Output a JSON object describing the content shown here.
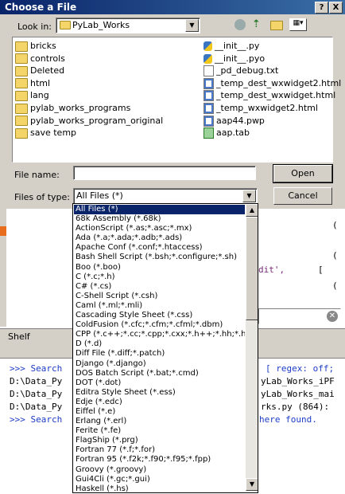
{
  "window": {
    "title": "Choose a File",
    "help_label": "?",
    "close_label": "X"
  },
  "look_in": {
    "label": "Look in:",
    "value": "PyLab_Works"
  },
  "files_left": [
    "bricks",
    "controls",
    "Deleted",
    "html",
    "lang",
    "pylab_works_programs",
    "pylab_works_program_original",
    "save temp"
  ],
  "files_right": [
    {
      "name": "__init__.py",
      "icon": "python-file-icon"
    },
    {
      "name": "__init__.pyo",
      "icon": "python-file-icon"
    },
    {
      "name": "_pd_debug.txt",
      "icon": "text-file-icon"
    },
    {
      "name": "_temp_dest_wxwidget2.html",
      "icon": "html-file-icon"
    },
    {
      "name": "_temp_dest_wxwidget.html",
      "icon": "html-file-icon"
    },
    {
      "name": "_temp_wxwidget2.html",
      "icon": "html-file-icon"
    },
    {
      "name": "aap44.pwp",
      "icon": "html-file-icon"
    },
    {
      "name": "aap.tab",
      "icon": "tab-file-icon"
    }
  ],
  "file_name": {
    "label": "File name:",
    "value": ""
  },
  "files_of_type": {
    "label": "Files of type:",
    "value": "All Files (*)"
  },
  "buttons": {
    "open": "Open",
    "cancel": "Cancel"
  },
  "type_options": [
    "All Files (*)",
    "68k Assembly (*.68k)",
    "ActionScript (*.as;*.asc;*.mx)",
    "Ada (*.a;*.ada;*.adb;*.ads)",
    "Apache Conf (*.conf;*.htaccess)",
    "Bash Shell Script (*.bsh;*.configure;*.sh)",
    "Boo (*.boo)",
    "C (*.c;*.h)",
    "C# (*.cs)",
    "C-Shell Script (*.csh)",
    "Caml (*.ml;*.mli)",
    "Cascading Style Sheet (*.css)",
    "ColdFusion (*.cfc;*.cfm;*.cfml;*.dbm)",
    "CPP (*.c++;*.cc;*.cpp;*.cxx;*.h++;*.hh;*.hpp;*",
    "D (*.d)",
    "Diff File (*.diff;*.patch)",
    "Django (*.django)",
    "DOS Batch Script (*.bat;*.cmd)",
    "DOT (*.dot)",
    "Editra Style Sheet (*.ess)",
    "Edje (*.edc)",
    "Eiffel (*.e)",
    "Erlang (*.erl)",
    "Ferite (*.fe)",
    "FlagShip (*.prg)",
    "Fortran 77 (*.f;*.for)",
    "Fortran 95 (*.f2k;*.f90;*.f95;*.fpp)",
    "Groovy (*.groovy)",
    "Gui4Cli (*.gc;*.gui)",
    "Haskell (*.hs)"
  ],
  "background": {
    "shelf_label": "Shelf",
    "code_fragments": [
      "dit',",
      "[",
      "(",
      "(",
      "("
    ],
    "console_lines": [
      ">>> Search",
      "D:\\Data_Py",
      "D:\\Data_Py",
      "D:\\Data_Py",
      ">>> Search"
    ],
    "console_right": [
      "[ regex: off;",
      "yLab_Works_iPF",
      "yLab_Works_mai",
      "rks.py (864):",
      "here found."
    ]
  }
}
